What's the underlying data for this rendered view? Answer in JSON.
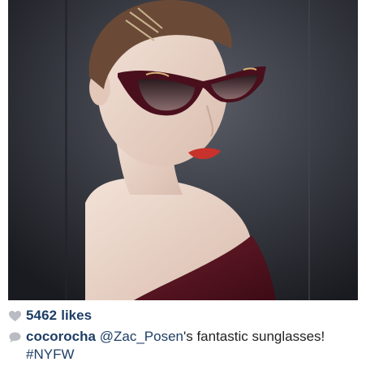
{
  "post": {
    "image": {
      "alt_icon": "photo-portrait",
      "colors": {
        "background": "#2a2c33",
        "garment": "#5a1623",
        "lips": "#c8322c",
        "frames": "#4a0f1c"
      }
    },
    "likes": {
      "count": "5462",
      "label": "likes",
      "icon": "heart-icon"
    },
    "comment": {
      "icon": "comment-bubble-icon",
      "username": "cocorocha",
      "mention": "@Zac_Posen",
      "text_after_mention": "'s fantastic sunglasses! ",
      "hashtag": "#NYFW"
    }
  }
}
